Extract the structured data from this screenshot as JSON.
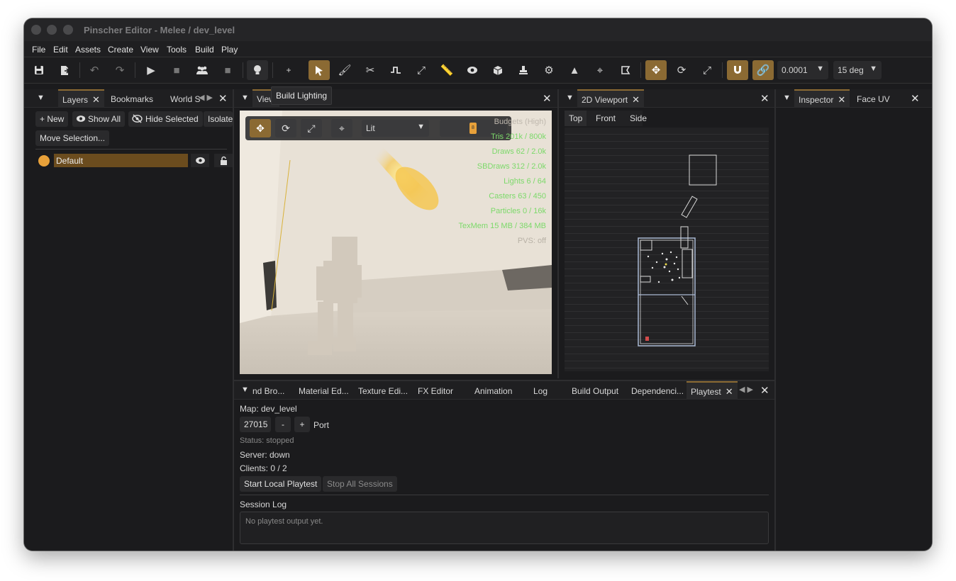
{
  "window": {
    "title": "Pinscher Editor - Melee / dev_level"
  },
  "menu": [
    "File",
    "Edit",
    "Assets",
    "Create",
    "View",
    "Tools",
    "Build",
    "Play"
  ],
  "toolbar": {
    "snap_value": "0.0001",
    "angle_value": "15 deg",
    "tooltip": "Build Lighting",
    "plus_label": "+"
  },
  "layers_panel": {
    "tabs": [
      "Layers",
      "Bookmarks",
      "World S"
    ],
    "buttons": {
      "new": "+ New",
      "show_all": "Show All",
      "hide_selected": "Hide Selected",
      "isolate": "Isolate",
      "move_selection": "Move Selection..."
    },
    "layers": [
      {
        "name": "Default",
        "color": "#e8a13a"
      }
    ]
  },
  "viewport": {
    "tab": "View",
    "render_mode": "Lit",
    "slider_value": "8",
    "budgets_title": "Budgets (High)",
    "budgets": [
      "Tris  201k / 800k",
      "Draws  62 / 2.0k",
      "SBDraws  312 / 2.0k",
      "Lights  6 / 64",
      "Casters  63 / 450",
      "Particles  0 / 16k",
      "TexMem  15 MB / 384 MB"
    ],
    "pvs_label": "PVS: off"
  },
  "viewport2d": {
    "tab": "2D Viewport",
    "views": [
      "Top",
      "Front",
      "Side"
    ]
  },
  "inspector": {
    "tabs": [
      "Inspector",
      "Face UV"
    ]
  },
  "bottom_panel": {
    "tabs": [
      "nd Bro...",
      "Material Ed...",
      "Texture Edi...",
      "FX Editor",
      "Animation",
      "Log",
      "Build Output",
      "Dependenci...",
      "Playtest"
    ],
    "map_label": "Map: dev_level",
    "port_value": "27015",
    "minus": "-",
    "plus": "+",
    "port_label": "Port",
    "status": "Status: stopped",
    "server": "Server: down",
    "clients": "Clients: 0 / 2",
    "start_btn": "Start Local Playtest",
    "stop_btn": "Stop All Sessions",
    "session_log_title": "Session Log",
    "log_placeholder": "No playtest output yet."
  },
  "colors": {
    "accent": "#8b6a33",
    "budget_text": "#7cd96a",
    "layer_dot": "#e8a13a"
  }
}
